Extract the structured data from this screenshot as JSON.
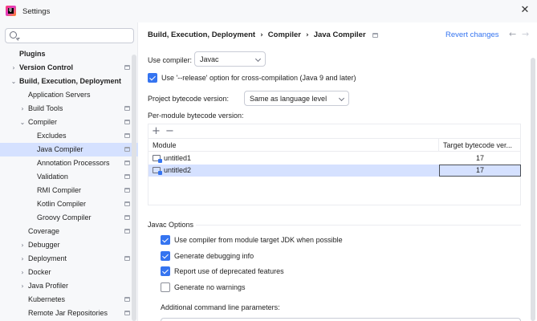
{
  "window": {
    "title": "Settings",
    "logo_text": "IJ",
    "close_glyph": "✕"
  },
  "sidebar": {
    "search": {
      "placeholder": "",
      "value": ""
    },
    "items": [
      {
        "label": "Plugins",
        "bold": true,
        "chevron": "",
        "selected": false,
        "project_icon": false
      },
      {
        "label": "Version Control",
        "bold": true,
        "chevron": "›",
        "selected": false,
        "project_icon": true
      },
      {
        "label": "Build, Execution, Deployment",
        "bold": true,
        "chevron": "⌄",
        "selected": false,
        "project_icon": false
      },
      {
        "label": "Application Servers",
        "bold": false,
        "chevron": "",
        "selected": false,
        "project_icon": false
      },
      {
        "label": "Build Tools",
        "bold": false,
        "chevron": "›",
        "selected": false,
        "project_icon": true
      },
      {
        "label": "Compiler",
        "bold": false,
        "chevron": "⌄",
        "selected": false,
        "project_icon": true
      },
      {
        "label": "Excludes",
        "bold": false,
        "chevron": "",
        "selected": false,
        "project_icon": true
      },
      {
        "label": "Java Compiler",
        "bold": false,
        "chevron": "",
        "selected": true,
        "project_icon": true
      },
      {
        "label": "Annotation Processors",
        "bold": false,
        "chevron": "",
        "selected": false,
        "project_icon": true
      },
      {
        "label": "Validation",
        "bold": false,
        "chevron": "",
        "selected": false,
        "project_icon": true
      },
      {
        "label": "RMI Compiler",
        "bold": false,
        "chevron": "",
        "selected": false,
        "project_icon": true
      },
      {
        "label": "Kotlin Compiler",
        "bold": false,
        "chevron": "",
        "selected": false,
        "project_icon": true
      },
      {
        "label": "Groovy Compiler",
        "bold": false,
        "chevron": "",
        "selected": false,
        "project_icon": true
      },
      {
        "label": "Coverage",
        "bold": false,
        "chevron": "",
        "selected": false,
        "project_icon": true
      },
      {
        "label": "Debugger",
        "bold": false,
        "chevron": "›",
        "selected": false,
        "project_icon": false
      },
      {
        "label": "Deployment",
        "bold": false,
        "chevron": "›",
        "selected": false,
        "project_icon": true
      },
      {
        "label": "Docker",
        "bold": false,
        "chevron": "›",
        "selected": false,
        "project_icon": false
      },
      {
        "label": "Java Profiler",
        "bold": false,
        "chevron": "›",
        "selected": false,
        "project_icon": false
      },
      {
        "label": "Kubernetes",
        "bold": false,
        "chevron": "",
        "selected": false,
        "project_icon": true
      },
      {
        "label": "Remote Jar Repositories",
        "bold": false,
        "chevron": "",
        "selected": false,
        "project_icon": true
      }
    ]
  },
  "header": {
    "breadcrumb": [
      "Build, Execution, Deployment",
      "Compiler",
      "Java Compiler"
    ],
    "separator": "›",
    "revert_label": "Revert changes",
    "back_glyph": "←",
    "forward_glyph": "→"
  },
  "form": {
    "use_compiler_label": "Use compiler:",
    "use_compiler_value": "Javac",
    "release_option_label": "Use '--release' option for cross-compilation (Java 9 and later)",
    "release_option_checked": true,
    "bytecode_label": "Project bytecode version:",
    "bytecode_value": "Same as language level",
    "per_module_label": "Per-module bytecode version:"
  },
  "table": {
    "add_glyph": "+",
    "remove_glyph": "−",
    "columns": [
      "Module",
      "Target bytecode ver..."
    ],
    "rows": [
      {
        "module": "untitled1",
        "target": "17",
        "selected": false
      },
      {
        "module": "untitled2",
        "target": "17",
        "selected": true
      }
    ]
  },
  "javac_options": {
    "title": "Javac Options",
    "options": [
      {
        "label": "Use compiler from module target JDK when possible",
        "checked": true
      },
      {
        "label": "Generate debugging info",
        "checked": true
      },
      {
        "label": "Report use of deprecated features",
        "checked": true
      },
      {
        "label": "Generate no warnings",
        "checked": false
      }
    ],
    "additional_params_label": "Additional command line parameters:",
    "additional_params_value": ""
  },
  "colors": {
    "accent": "#3574f0",
    "selection": "#d5e1ff",
    "sidebar_bg": "#f7f8fa"
  }
}
